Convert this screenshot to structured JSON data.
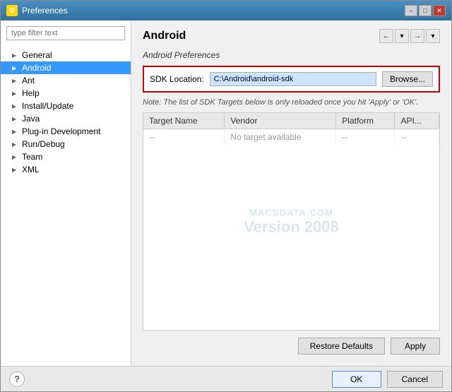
{
  "window": {
    "title": "Preferences",
    "icon": "⚙"
  },
  "titlebar": {
    "minimize_label": "–",
    "maximize_label": "□",
    "close_label": "✕"
  },
  "sidebar": {
    "filter_placeholder": "type filter text",
    "items": [
      {
        "label": "General",
        "arrow": "▶",
        "selected": false
      },
      {
        "label": "Android",
        "arrow": "▶",
        "selected": true
      },
      {
        "label": "Ant",
        "arrow": "▶",
        "selected": false
      },
      {
        "label": "Help",
        "arrow": "▶",
        "selected": false
      },
      {
        "label": "Install/Update",
        "arrow": "▶",
        "selected": false
      },
      {
        "label": "Java",
        "arrow": "▶",
        "selected": false
      },
      {
        "label": "Plug-in Development",
        "arrow": "▶",
        "selected": false
      },
      {
        "label": "Run/Debug",
        "arrow": "▶",
        "selected": false
      },
      {
        "label": "Team",
        "arrow": "▶",
        "selected": false
      },
      {
        "label": "XML",
        "arrow": "▶",
        "selected": false
      }
    ]
  },
  "panel": {
    "title": "Android",
    "section_label": "Android Preferences",
    "sdk_label": "SDK Location:",
    "sdk_value": "C:\\Android\\android-sdk",
    "browse_label": "Browse...",
    "note": "Note: The list of SDK Targets below is only reloaded once you hit 'Apply' or 'OK'.",
    "table": {
      "columns": [
        "Target Name",
        "Vendor",
        "Platform",
        "API..."
      ],
      "rows": [
        {
          "name": "--",
          "vendor": "No target available",
          "platform": "--",
          "api": "--"
        }
      ]
    },
    "watermark": {
      "site": "MACSDATA.COM",
      "version": "Version 2008"
    },
    "restore_defaults_label": "Restore Defaults",
    "apply_label": "Apply"
  },
  "footer": {
    "help_label": "?",
    "ok_label": "OK",
    "cancel_label": "Cancel"
  },
  "nav": {
    "back": "←",
    "dropdown": "▾",
    "forward": "→",
    "menu": "▾"
  }
}
